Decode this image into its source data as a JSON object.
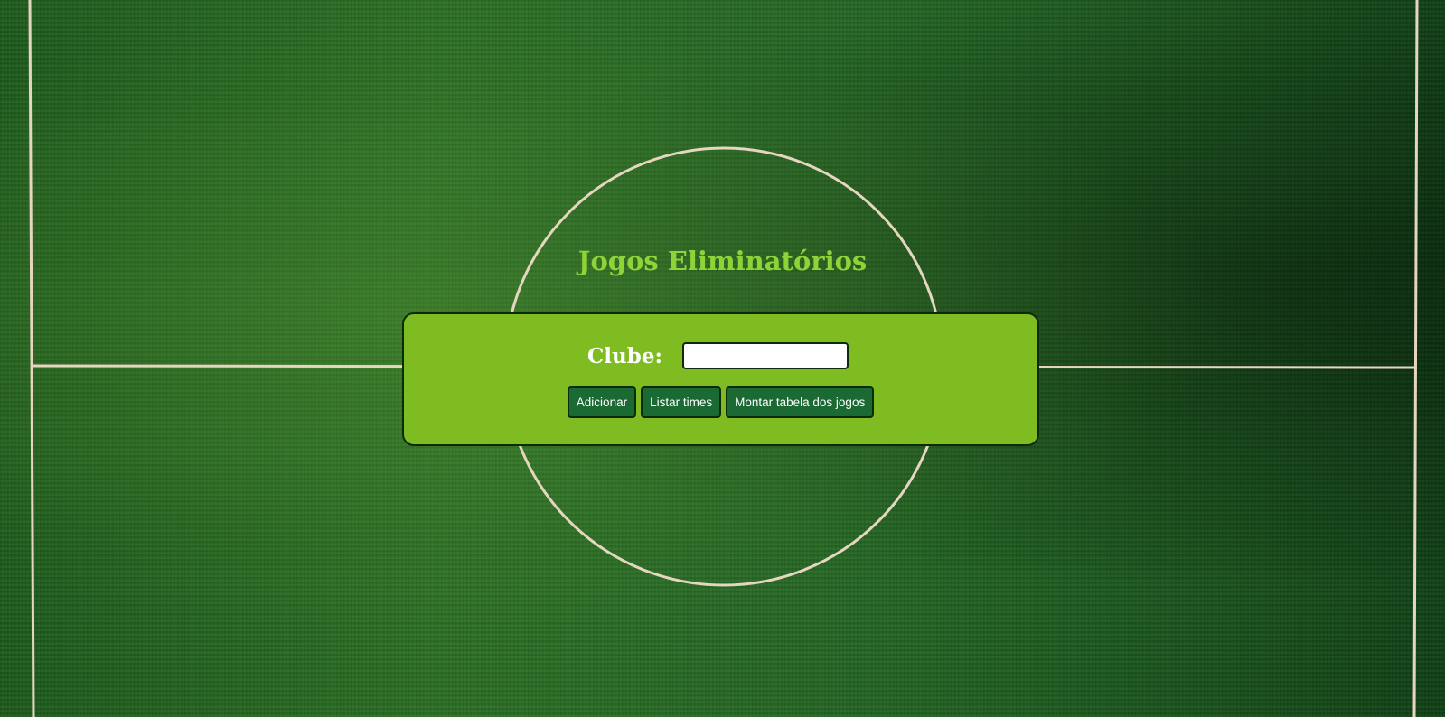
{
  "page": {
    "title": "Jogos Eliminatórios"
  },
  "form": {
    "club_label": "Clube:",
    "club_value": "",
    "club_placeholder": ""
  },
  "buttons": {
    "add_label": "Adicionar",
    "list_label": "Listar times",
    "build_label": "Montar tabela dos jogos"
  },
  "colors": {
    "title": "#8ed438",
    "panel": "#7ebc22",
    "button": "#1c6a33",
    "field_line": "#e8d9c4",
    "grass": "#2b6f24"
  }
}
